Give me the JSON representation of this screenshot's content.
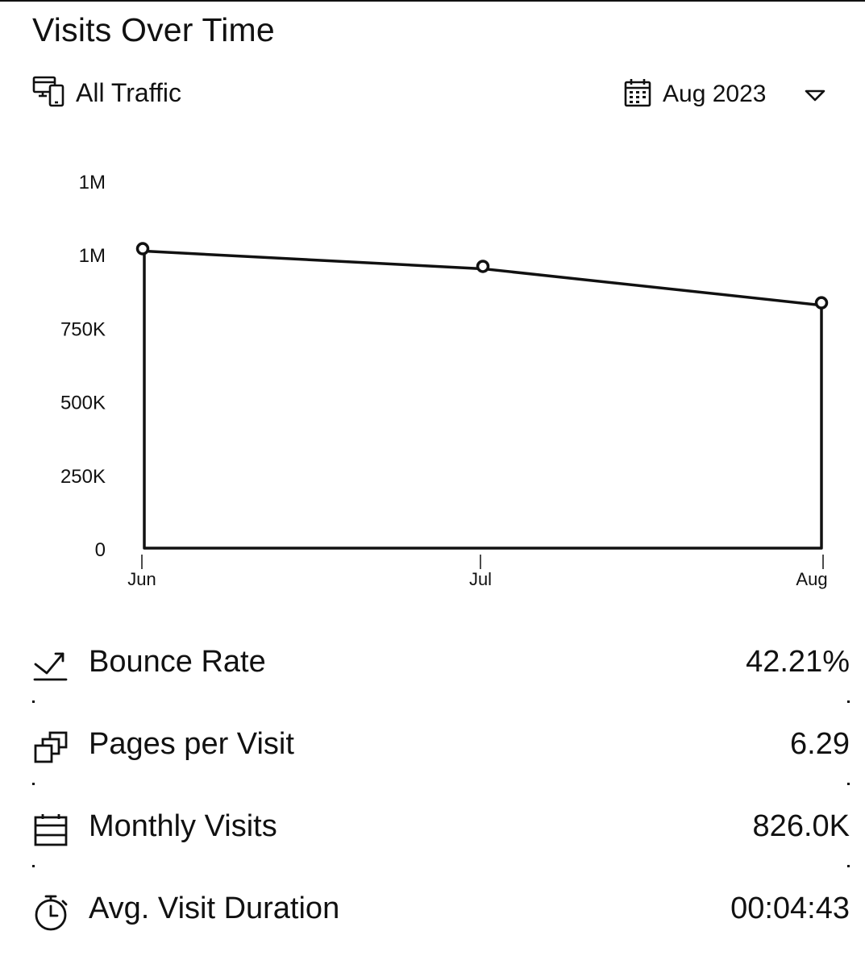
{
  "header": {
    "title": "Visits Over Time"
  },
  "filters": {
    "traffic_label": "All Traffic",
    "traffic_icon": "devices-icon",
    "date_label": "Aug 2023",
    "date_icon": "calendar-icon",
    "date_chevron_icon": "chevron-down-icon"
  },
  "chart_data": {
    "type": "area",
    "categories": [
      "Jun",
      "Jul",
      "Aug"
    ],
    "values": [
      1010000,
      950000,
      826000
    ],
    "y_ticks": [
      {
        "value": 0,
        "label": "0"
      },
      {
        "value": 250000,
        "label": "250K"
      },
      {
        "value": 500000,
        "label": "500K"
      },
      {
        "value": 750000,
        "label": "750K"
      },
      {
        "value": 1000000,
        "label": "1M"
      },
      {
        "value": 1250000,
        "label": "1M"
      }
    ],
    "ylim": [
      0,
      1250000
    ],
    "grid": false,
    "line_color": "#111111",
    "fill_color": "#ffffff"
  },
  "metrics": [
    {
      "icon": "bounce-arrow-icon",
      "label": "Bounce Rate",
      "value": "42.21%"
    },
    {
      "icon": "pages-stack-icon",
      "label": "Pages per Visit",
      "value": "6.29"
    },
    {
      "icon": "calendar-list-icon",
      "label": "Monthly Visits",
      "value": "826.0K"
    },
    {
      "icon": "stopwatch-icon",
      "label": "Avg. Visit Duration",
      "value": "00:04:43"
    }
  ]
}
